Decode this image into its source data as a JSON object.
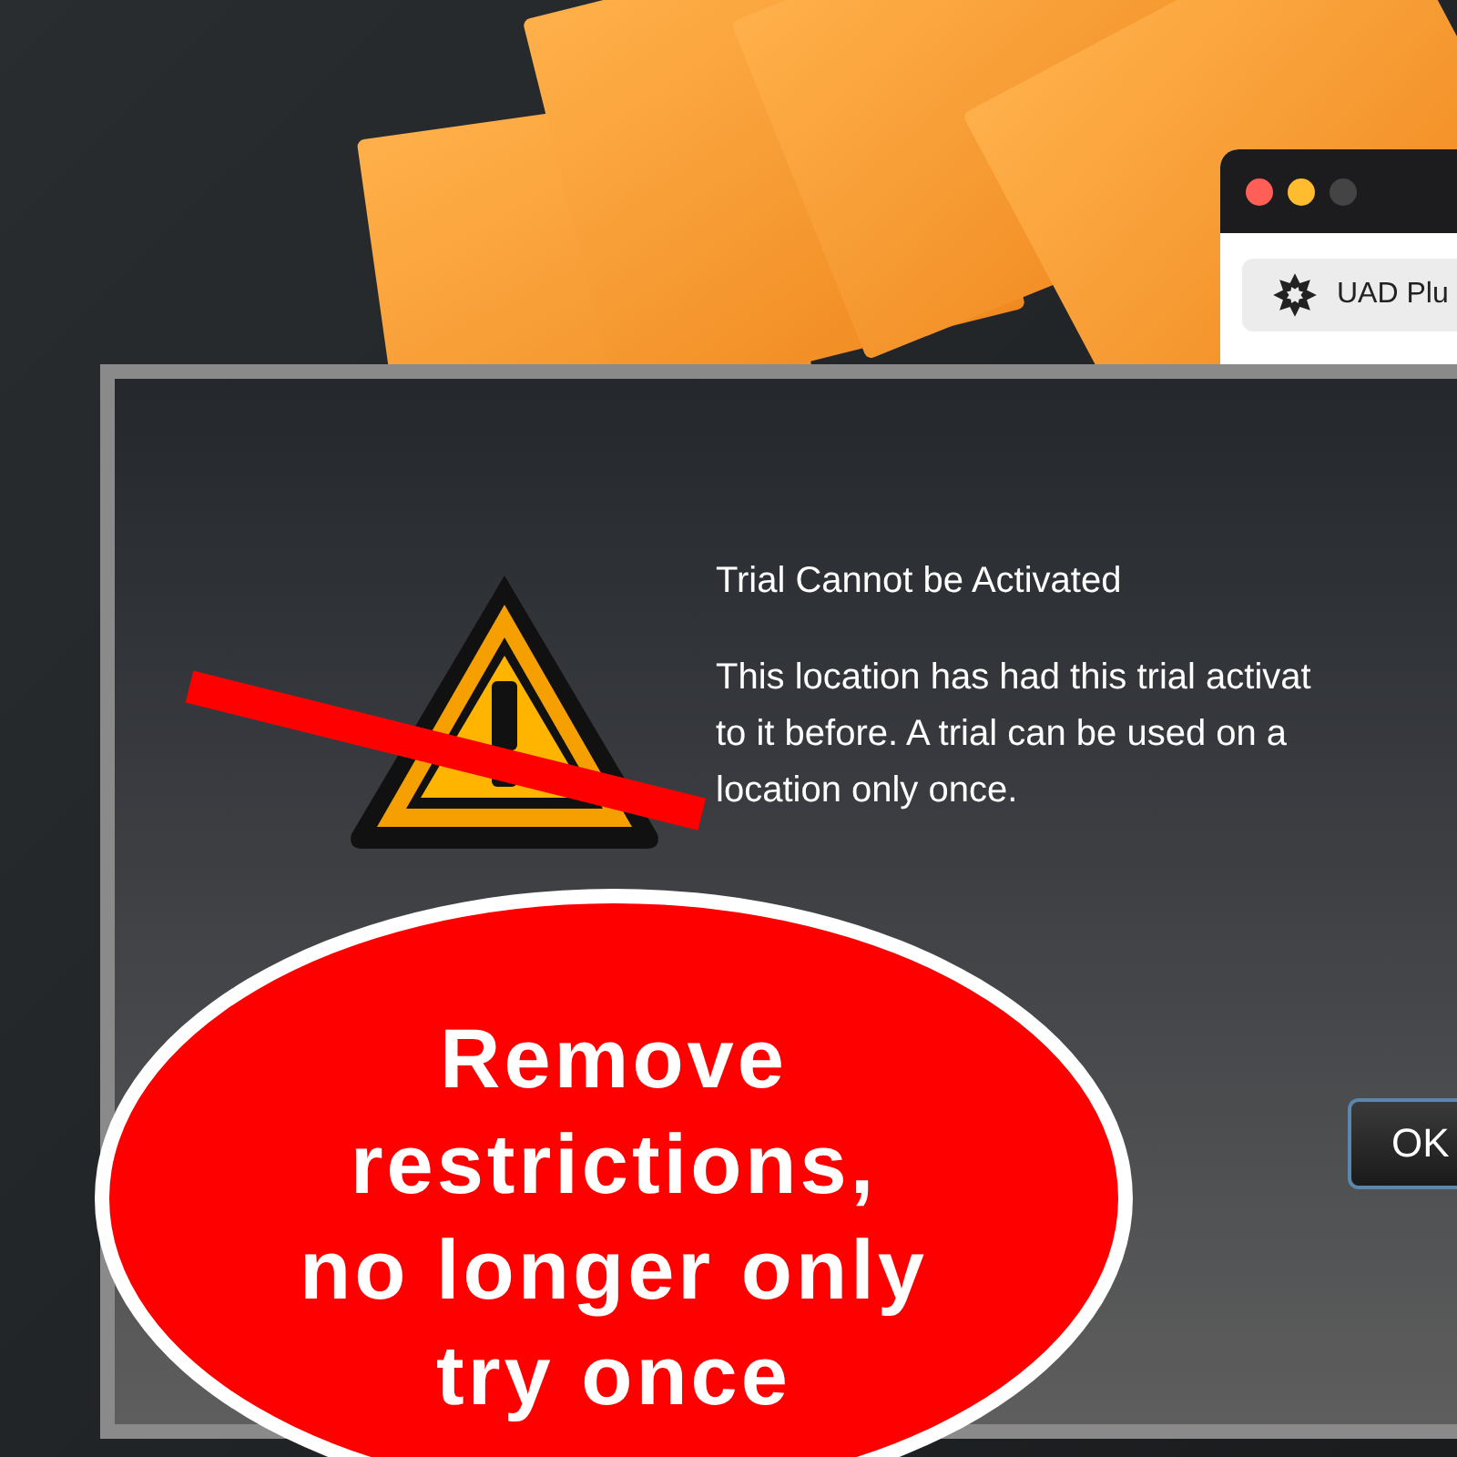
{
  "background_window": {
    "tab_label": "UAD Plu"
  },
  "dialog": {
    "title": "Trial Cannot be Activated",
    "message": "This location has had this trial activat\nto it before. A trial can be used on a\nlocation only once.",
    "buttons": [
      "OK"
    ]
  },
  "banner": {
    "text": "Remove\nrestrictions,\nno longer only\ntry once"
  }
}
